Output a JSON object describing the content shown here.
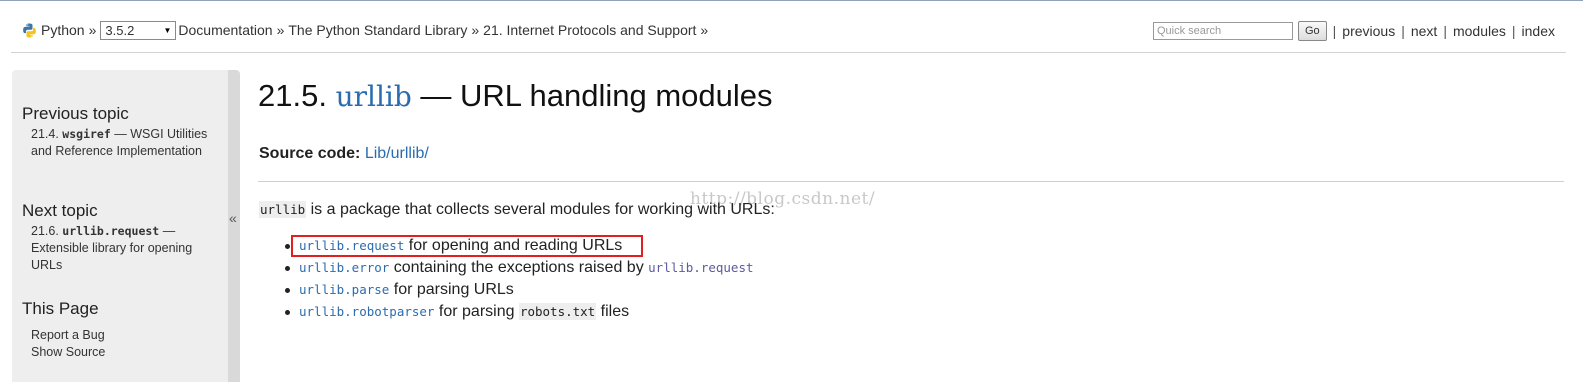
{
  "header": {
    "crumbs": {
      "python": "Python",
      "version": "3.5.2",
      "documentation": "Documentation",
      "stdlib": "The Python Standard Library",
      "chapter": "21. Internet Protocols and Support",
      "sep": "»"
    },
    "search": {
      "placeholder": "Quick search",
      "go_label": "Go"
    },
    "nav": {
      "previous": "previous",
      "next": "next",
      "modules": "modules",
      "index": "index",
      "sep": "|"
    }
  },
  "sidebar": {
    "collapse_glyph": "«",
    "previous": {
      "heading": "Previous topic",
      "num": "21.4.",
      "module": "wsgiref",
      "desc": "— WSGI Utilities and Reference Implementation"
    },
    "next": {
      "heading": "Next topic",
      "num": "21.6.",
      "module": "urllib.request",
      "desc": "— Extensible library for opening URLs"
    },
    "this_page": {
      "heading": "This Page",
      "report": "Report a Bug",
      "show_source": "Show Source"
    }
  },
  "main": {
    "title_num": "21.5.",
    "title_module": "urllib",
    "title_rest": "— URL handling modules",
    "source_label": "Source code:",
    "source_link": "Lib/urllib/",
    "intro_code": "urllib",
    "intro_text": " is a package that collects several modules for working with URLs:",
    "watermark": "http://blog.csdn.net/",
    "modules": [
      {
        "module": "urllib.request",
        "text": " for opening and reading URLs"
      },
      {
        "module": "urllib.error",
        "text": " containing the exceptions raised by ",
        "module2": "urllib.request"
      },
      {
        "module": "urllib.parse",
        "text": " for parsing URLs"
      },
      {
        "module": "urllib.robotparser",
        "text": " for parsing ",
        "code": "robots.txt",
        "text2": " files"
      }
    ]
  },
  "colors": {
    "link": "#2b6cb0",
    "highlight_box": "#e02020",
    "sidebar_bg": "#eeeeee"
  }
}
